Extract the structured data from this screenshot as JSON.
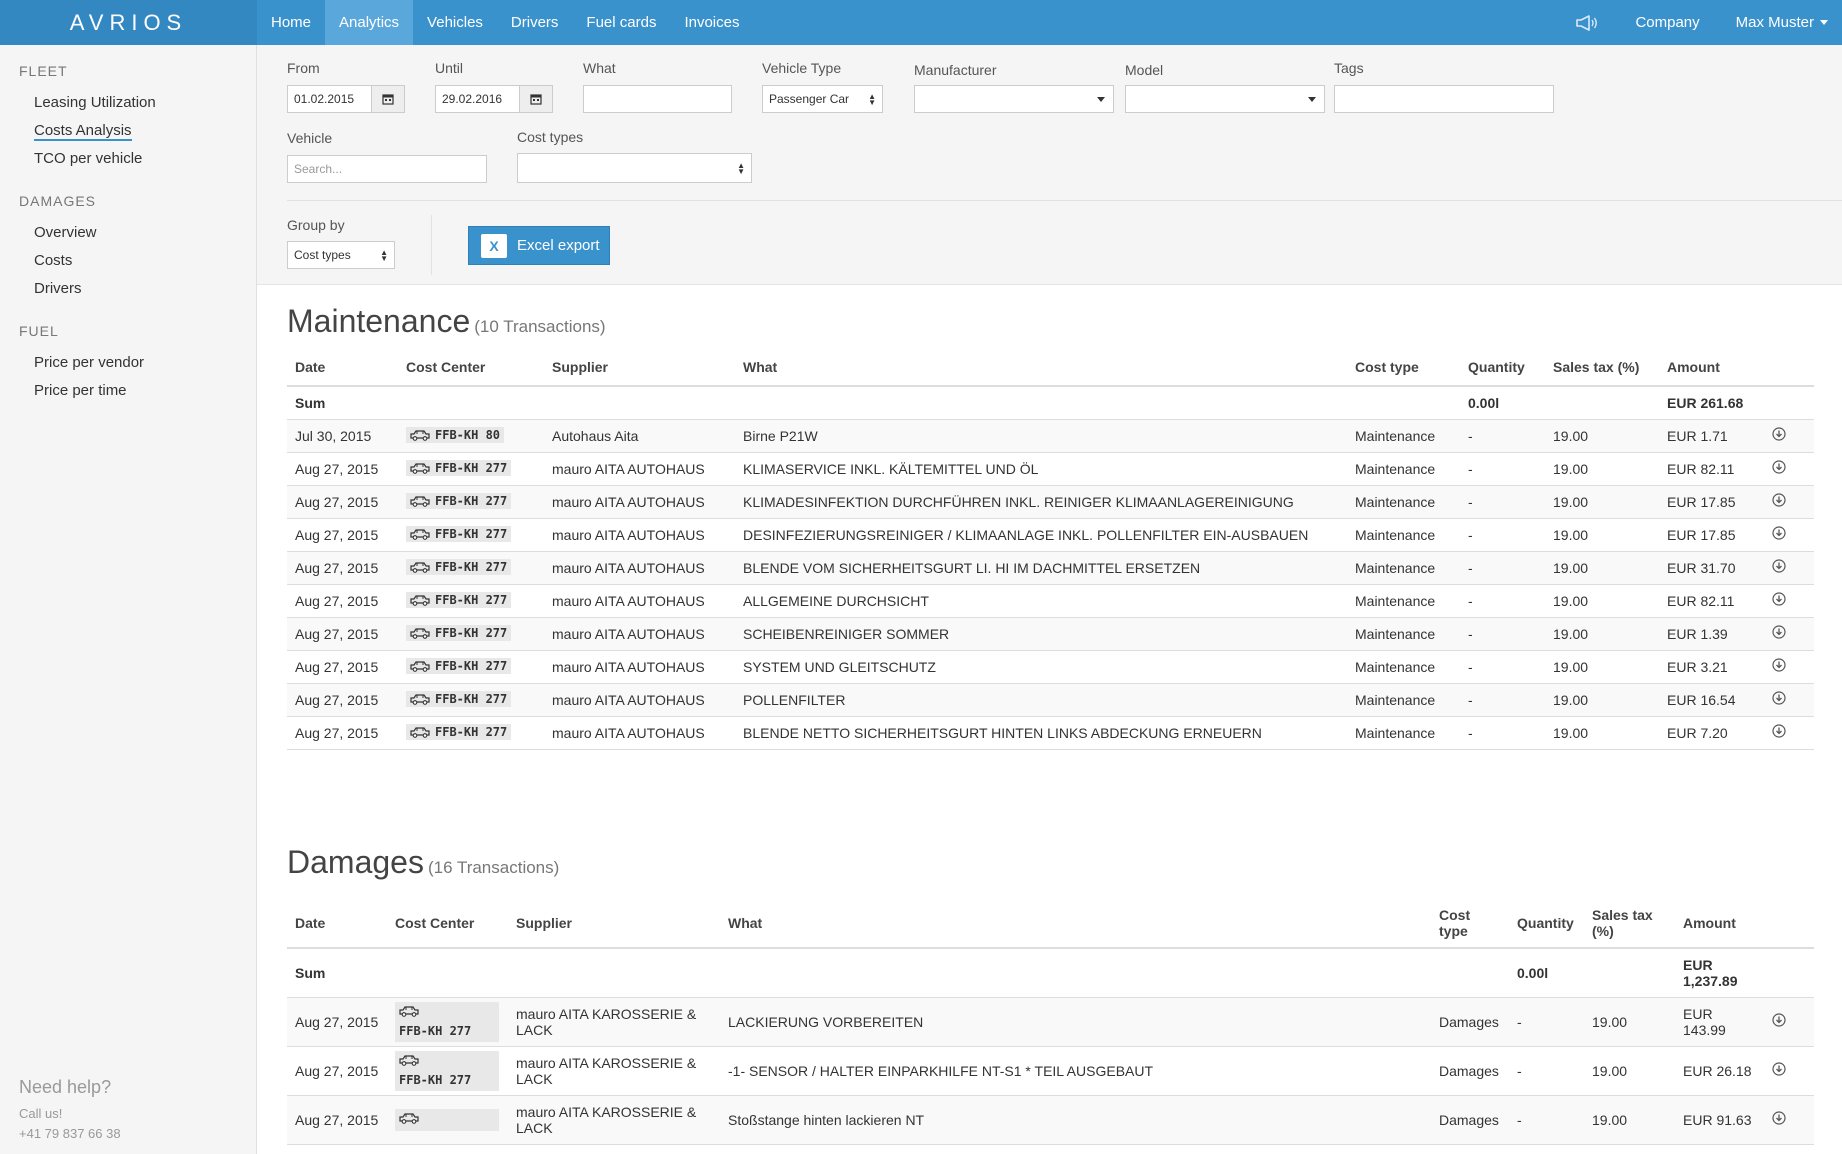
{
  "brand": "AVRIOS",
  "nav": {
    "items": [
      {
        "label": "Home",
        "active": false
      },
      {
        "label": "Analytics",
        "active": true
      },
      {
        "label": "Vehicles",
        "active": false
      },
      {
        "label": "Drivers",
        "active": false
      },
      {
        "label": "Fuel cards",
        "active": false
      },
      {
        "label": "Invoices",
        "active": false
      }
    ],
    "icon": "megaphone-icon",
    "company": "Company",
    "user": "Max Muster"
  },
  "sidebar": {
    "sections": [
      {
        "title": "FLEET",
        "items": [
          "Leasing Utilization",
          "Costs Analysis",
          "TCO per vehicle"
        ]
      },
      {
        "title": "DAMAGES",
        "items": [
          "Overview",
          "Costs",
          "Drivers"
        ]
      },
      {
        "title": "FUEL",
        "items": [
          "Price per vendor",
          "Price per time"
        ]
      }
    ],
    "active_item": "Costs Analysis",
    "help": {
      "title": "Need help?",
      "call": "Call us!",
      "phone": "+41 79 837 66 38"
    }
  },
  "filters": {
    "from": {
      "label": "From",
      "value": "01.02.2015"
    },
    "until": {
      "label": "Until",
      "value": "29.02.2016"
    },
    "what": {
      "label": "What",
      "value": ""
    },
    "vehicle_type": {
      "label": "Vehicle Type",
      "value": "Passenger Car"
    },
    "manufacturer": {
      "label": "Manufacturer",
      "value": ""
    },
    "model": {
      "label": "Model",
      "value": ""
    },
    "tags": {
      "label": "Tags",
      "value": ""
    },
    "vehicle": {
      "label": "Vehicle",
      "placeholder": "Search..."
    },
    "cost_types": {
      "label": "Cost types",
      "value": ""
    },
    "group_by": {
      "label": "Group by",
      "value": "Cost types"
    },
    "excel_export": "Excel export"
  },
  "maintenance": {
    "title": "Maintenance",
    "count": "(10 Transactions)",
    "columns": [
      "Date",
      "Cost Center",
      "Supplier",
      "What",
      "Cost type",
      "Quantity",
      "Sales tax (%)",
      "Amount"
    ],
    "sum": {
      "label": "Sum",
      "quantity": "0.00l",
      "amount": "EUR 261.68"
    },
    "rows": [
      {
        "date": "Jul 30, 2015",
        "plate": "FFB-KH 80",
        "supplier": "Autohaus Aita",
        "what": "Birne P21W",
        "type": "Maintenance",
        "qty": "-",
        "tax": "19.00",
        "amount": "EUR 1.71"
      },
      {
        "date": "Aug 27, 2015",
        "plate": "FFB-KH 277",
        "supplier": "mauro AITA AUTOHAUS",
        "what": "KLIMASERVICE INKL. KÄLTEMITTEL UND ÖL",
        "type": "Maintenance",
        "qty": "-",
        "tax": "19.00",
        "amount": "EUR 82.11"
      },
      {
        "date": "Aug 27, 2015",
        "plate": "FFB-KH 277",
        "supplier": "mauro AITA AUTOHAUS",
        "what": "KLIMADESINFEKTION DURCHFÜHREN INKL. REINIGER KLIMAANLAGEREINIGUNG",
        "type": "Maintenance",
        "qty": "-",
        "tax": "19.00",
        "amount": "EUR 17.85"
      },
      {
        "date": "Aug 27, 2015",
        "plate": "FFB-KH 277",
        "supplier": "mauro AITA AUTOHAUS",
        "what": "DESINFEZIERUNGSREINIGER / KLIMAANLAGE INKL. POLLENFILTER EIN-AUSBAUEN",
        "type": "Maintenance",
        "qty": "-",
        "tax": "19.00",
        "amount": "EUR 17.85"
      },
      {
        "date": "Aug 27, 2015",
        "plate": "FFB-KH 277",
        "supplier": "mauro AITA AUTOHAUS",
        "what": "BLENDE VOM SICHERHEITSGURT LI. HI IM DACHMITTEL ERSETZEN",
        "type": "Maintenance",
        "qty": "-",
        "tax": "19.00",
        "amount": "EUR 31.70"
      },
      {
        "date": "Aug 27, 2015",
        "plate": "FFB-KH 277",
        "supplier": "mauro AITA AUTOHAUS",
        "what": "ALLGEMEINE DURCHSICHT",
        "type": "Maintenance",
        "qty": "-",
        "tax": "19.00",
        "amount": "EUR 82.11"
      },
      {
        "date": "Aug 27, 2015",
        "plate": "FFB-KH 277",
        "supplier": "mauro AITA AUTOHAUS",
        "what": "SCHEIBENREINIGER SOMMER",
        "type": "Maintenance",
        "qty": "-",
        "tax": "19.00",
        "amount": "EUR 1.39"
      },
      {
        "date": "Aug 27, 2015",
        "plate": "FFB-KH 277",
        "supplier": "mauro AITA AUTOHAUS",
        "what": "SYSTEM UND GLEITSCHUTZ",
        "type": "Maintenance",
        "qty": "-",
        "tax": "19.00",
        "amount": "EUR 3.21"
      },
      {
        "date": "Aug 27, 2015",
        "plate": "FFB-KH 277",
        "supplier": "mauro AITA AUTOHAUS",
        "what": "POLLENFILTER",
        "type": "Maintenance",
        "qty": "-",
        "tax": "19.00",
        "amount": "EUR 16.54"
      },
      {
        "date": "Aug 27, 2015",
        "plate": "FFB-KH 277",
        "supplier": "mauro AITA AUTOHAUS",
        "what": "BLENDE NETTO SICHERHEITSGURT HINTEN LINKS ABDECKUNG ERNEUERN",
        "type": "Maintenance",
        "qty": "-",
        "tax": "19.00",
        "amount": "EUR 7.20"
      }
    ]
  },
  "damages": {
    "title": "Damages",
    "count": "(16 Transactions)",
    "columns": [
      "Date",
      "Cost Center",
      "Supplier",
      "What",
      "Cost type",
      "Quantity",
      "Sales tax (%)",
      "Amount"
    ],
    "sum": {
      "label": "Sum",
      "quantity": "0.00l",
      "amount": "EUR 1,237.89"
    },
    "rows": [
      {
        "date": "Aug 27, 2015",
        "plate": "FFB-KH 277",
        "supplier": "mauro AITA KAROSSERIE & LACK",
        "what": "LACKIERUNG VORBEREITEN",
        "type": "Damages",
        "qty": "-",
        "tax": "19.00",
        "amount": "EUR 143.99"
      },
      {
        "date": "Aug 27, 2015",
        "plate": "FFB-KH 277",
        "supplier": "mauro AITA KAROSSERIE & LACK",
        "what": "-1- SENSOR / HALTER EINPARKHILFE NT-S1 * TEIL AUSGEBAUT",
        "type": "Damages",
        "qty": "-",
        "tax": "19.00",
        "amount": "EUR 26.18"
      },
      {
        "date": "Aug 27, 2015",
        "plate": "",
        "supplier": "mauro AITA KAROSSERIE & LACK",
        "what": "Stoßstange hinten lackieren NT",
        "type": "Damages",
        "qty": "-",
        "tax": "19.00",
        "amount": "EUR 91.63"
      }
    ]
  }
}
